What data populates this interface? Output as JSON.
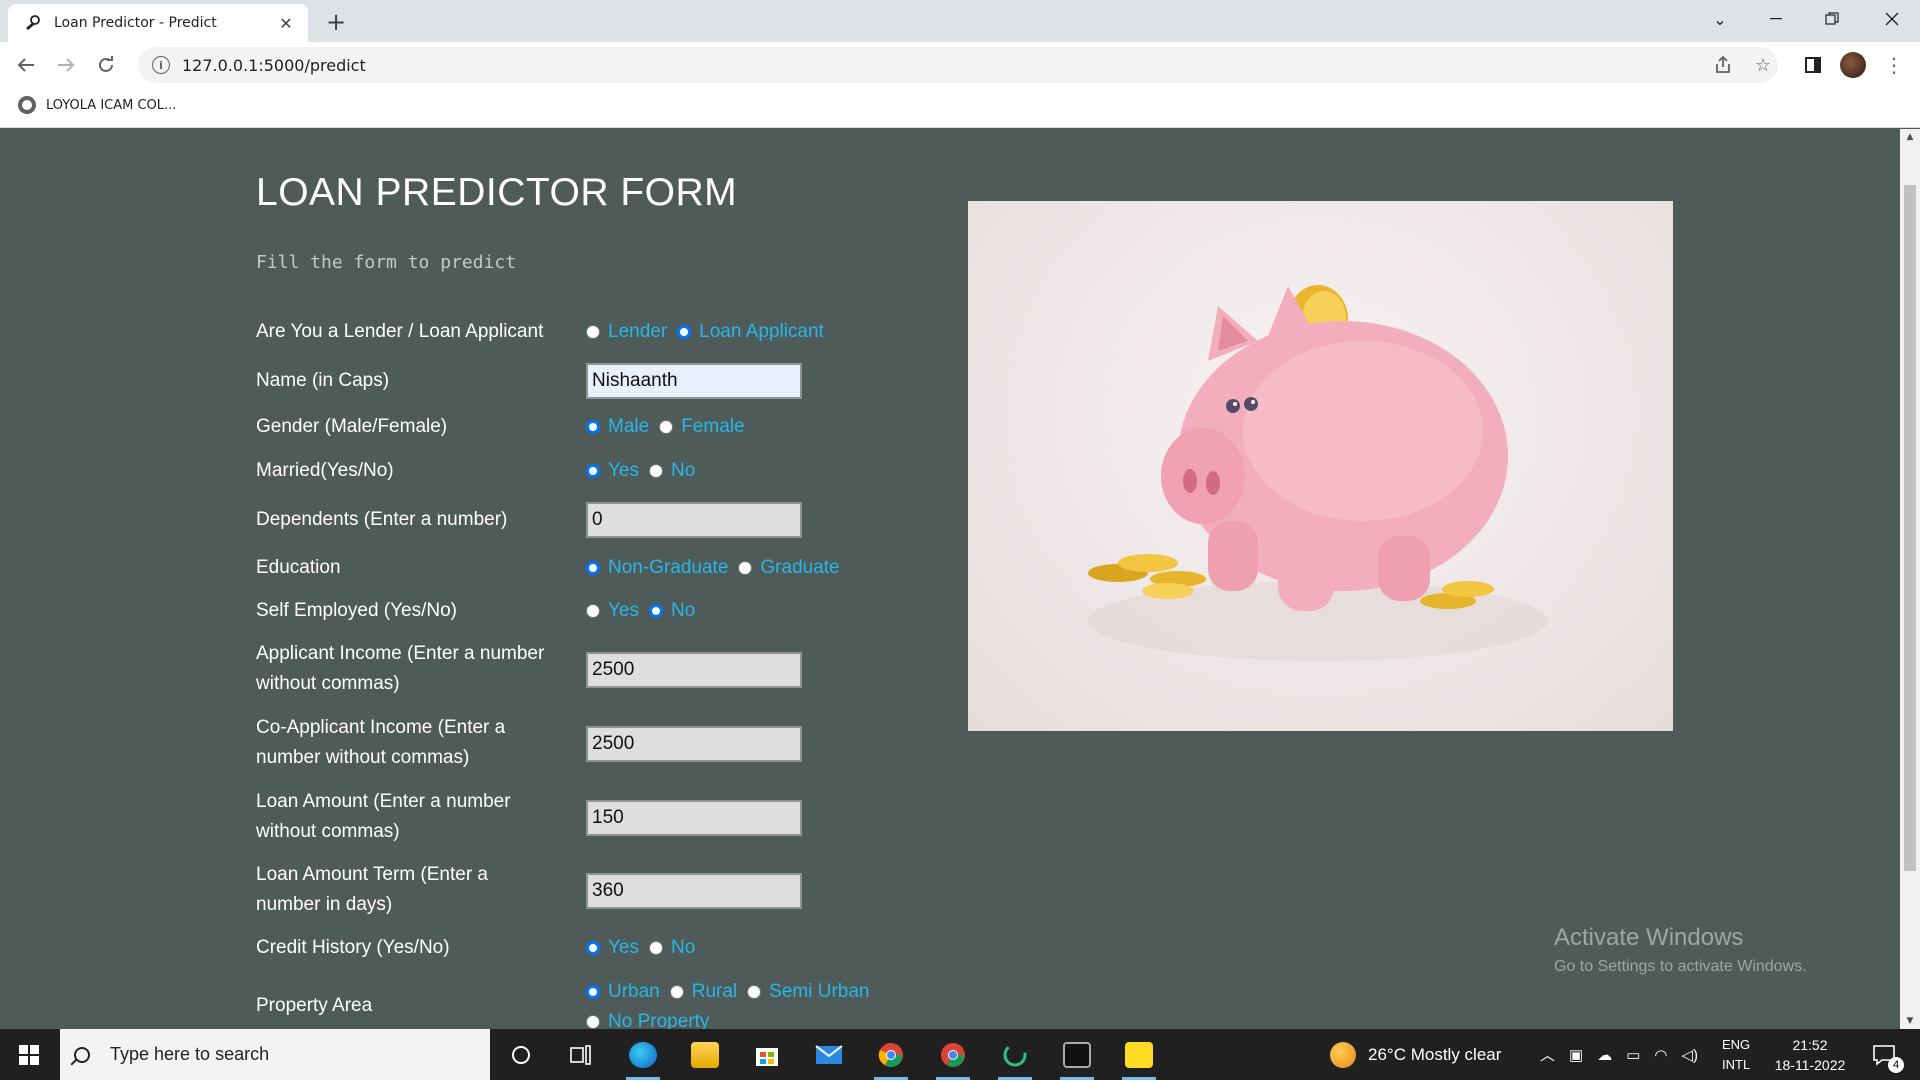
{
  "browser": {
    "tab_title": "Loan Predictor - Predict",
    "tab_close": "✕",
    "new_tab": "+",
    "url": "127.0.0.1:5000/predict",
    "bookmark": "LOYOLA ICAM COL..."
  },
  "form": {
    "title": "LOAN PREDICTOR FORM",
    "subtitle": "Fill the form to predict",
    "role": {
      "label": "Are You a Lender / Loan Applicant",
      "options": [
        "Lender",
        "Loan Applicant"
      ],
      "selected": "Loan Applicant"
    },
    "name": {
      "label": "Name (in Caps)",
      "value": "Nishaanth"
    },
    "gender": {
      "label": "Gender (Male/Female)",
      "options": [
        "Male",
        "Female"
      ],
      "selected": "Male"
    },
    "married": {
      "label": "Married(Yes/No)",
      "options": [
        "Yes",
        "No"
      ],
      "selected": "Yes"
    },
    "dependents": {
      "label": "Dependents (Enter a number)",
      "value": "0"
    },
    "education": {
      "label": "Education",
      "options": [
        "Non-Graduate",
        "Graduate"
      ],
      "selected": "Non-Graduate"
    },
    "self_employed": {
      "label": "Self Employed (Yes/No)",
      "options": [
        "Yes",
        "No"
      ],
      "selected": "No"
    },
    "applicant_income": {
      "label_line1": "Applicant Income (Enter a number",
      "label_line2": "without commas)",
      "value": "2500"
    },
    "coapplicant_income": {
      "label_line1": "Co-Applicant Income (Enter a",
      "label_line2": "number without commas)",
      "value": "2500"
    },
    "loan_amount": {
      "label_line1": "Loan Amount (Enter a number",
      "label_line2": "without commas)",
      "value": "150"
    },
    "loan_term": {
      "label_line1": "Loan Amount Term (Enter a",
      "label_line2": "number in days)",
      "value": "360"
    },
    "credit_history": {
      "label": "Credit History (Yes/No)",
      "options": [
        "Yes",
        "No"
      ],
      "selected": "Yes"
    },
    "property_area": {
      "label": "Property Area",
      "options": [
        "Urban",
        "Rural",
        "Semi Urban",
        "No Property"
      ],
      "selected": "Urban"
    }
  },
  "watermark": {
    "line1": "Activate Windows",
    "line2": "Go to Settings to activate Windows."
  },
  "taskbar": {
    "search_placeholder": "Type here to search",
    "weather": "26°C  Mostly clear",
    "lang1": "ENG",
    "lang2": "INTL",
    "time": "21:52",
    "date": "18-11-2022",
    "notification_count": "4"
  }
}
